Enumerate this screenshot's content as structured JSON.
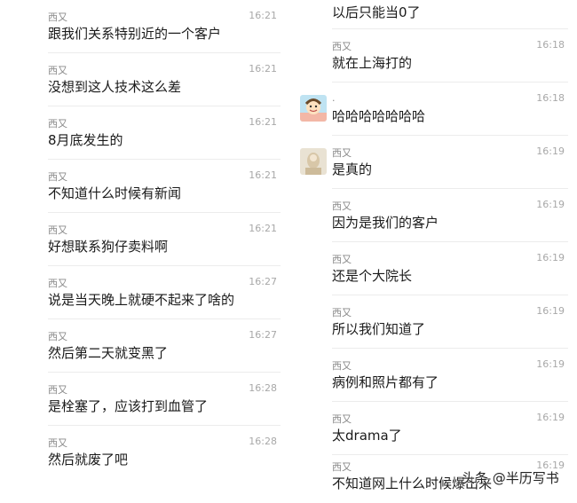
{
  "left_messages": [
    {
      "sender": "西又",
      "time": "16:21",
      "text": "跟我们关系特别近的一个客户"
    },
    {
      "sender": "西又",
      "time": "16:21",
      "text": "没想到这人技术这么差"
    },
    {
      "sender": "西又",
      "time": "16:21",
      "text": "8月底发生的"
    },
    {
      "sender": "西又",
      "time": "16:21",
      "text": "不知道什么时候有新闻"
    },
    {
      "sender": "西又",
      "time": "16:21",
      "text": "好想联系狗仔卖料啊"
    },
    {
      "sender": "西又",
      "time": "16:27",
      "text": "说是当天晚上就硬不起来了啥的"
    },
    {
      "sender": "西又",
      "time": "16:27",
      "text": "然后第二天就变黑了"
    },
    {
      "sender": "西又",
      "time": "16:28",
      "text": "是栓塞了，应该打到血管了"
    },
    {
      "sender": "西又",
      "time": "16:28",
      "text": "然后就废了吧"
    }
  ],
  "right_top_fragment": {
    "text": "以后只能当0了"
  },
  "right_messages": [
    {
      "sender": "西又",
      "time": "16:18",
      "text": "就在上海打的"
    },
    {
      "sender": ".",
      "time": "16:18",
      "text": "哈哈哈哈哈哈哈"
    },
    {
      "sender": "西又",
      "time": "16:19",
      "text": "是真的"
    },
    {
      "sender": "西又",
      "time": "16:19",
      "text": "因为是我们的客户"
    },
    {
      "sender": "西又",
      "time": "16:19",
      "text": "还是个大院长"
    },
    {
      "sender": "西又",
      "time": "16:19",
      "text": "所以我们知道了"
    },
    {
      "sender": "西又",
      "time": "16:19",
      "text": "病例和照片都有了"
    },
    {
      "sender": "西又",
      "time": "16:19",
      "text": "太drama了"
    },
    {
      "sender": "西又",
      "time": "16:19",
      "text": "不知道网上什么时候爆出来"
    }
  ],
  "watermark": "头条 @半历写书"
}
